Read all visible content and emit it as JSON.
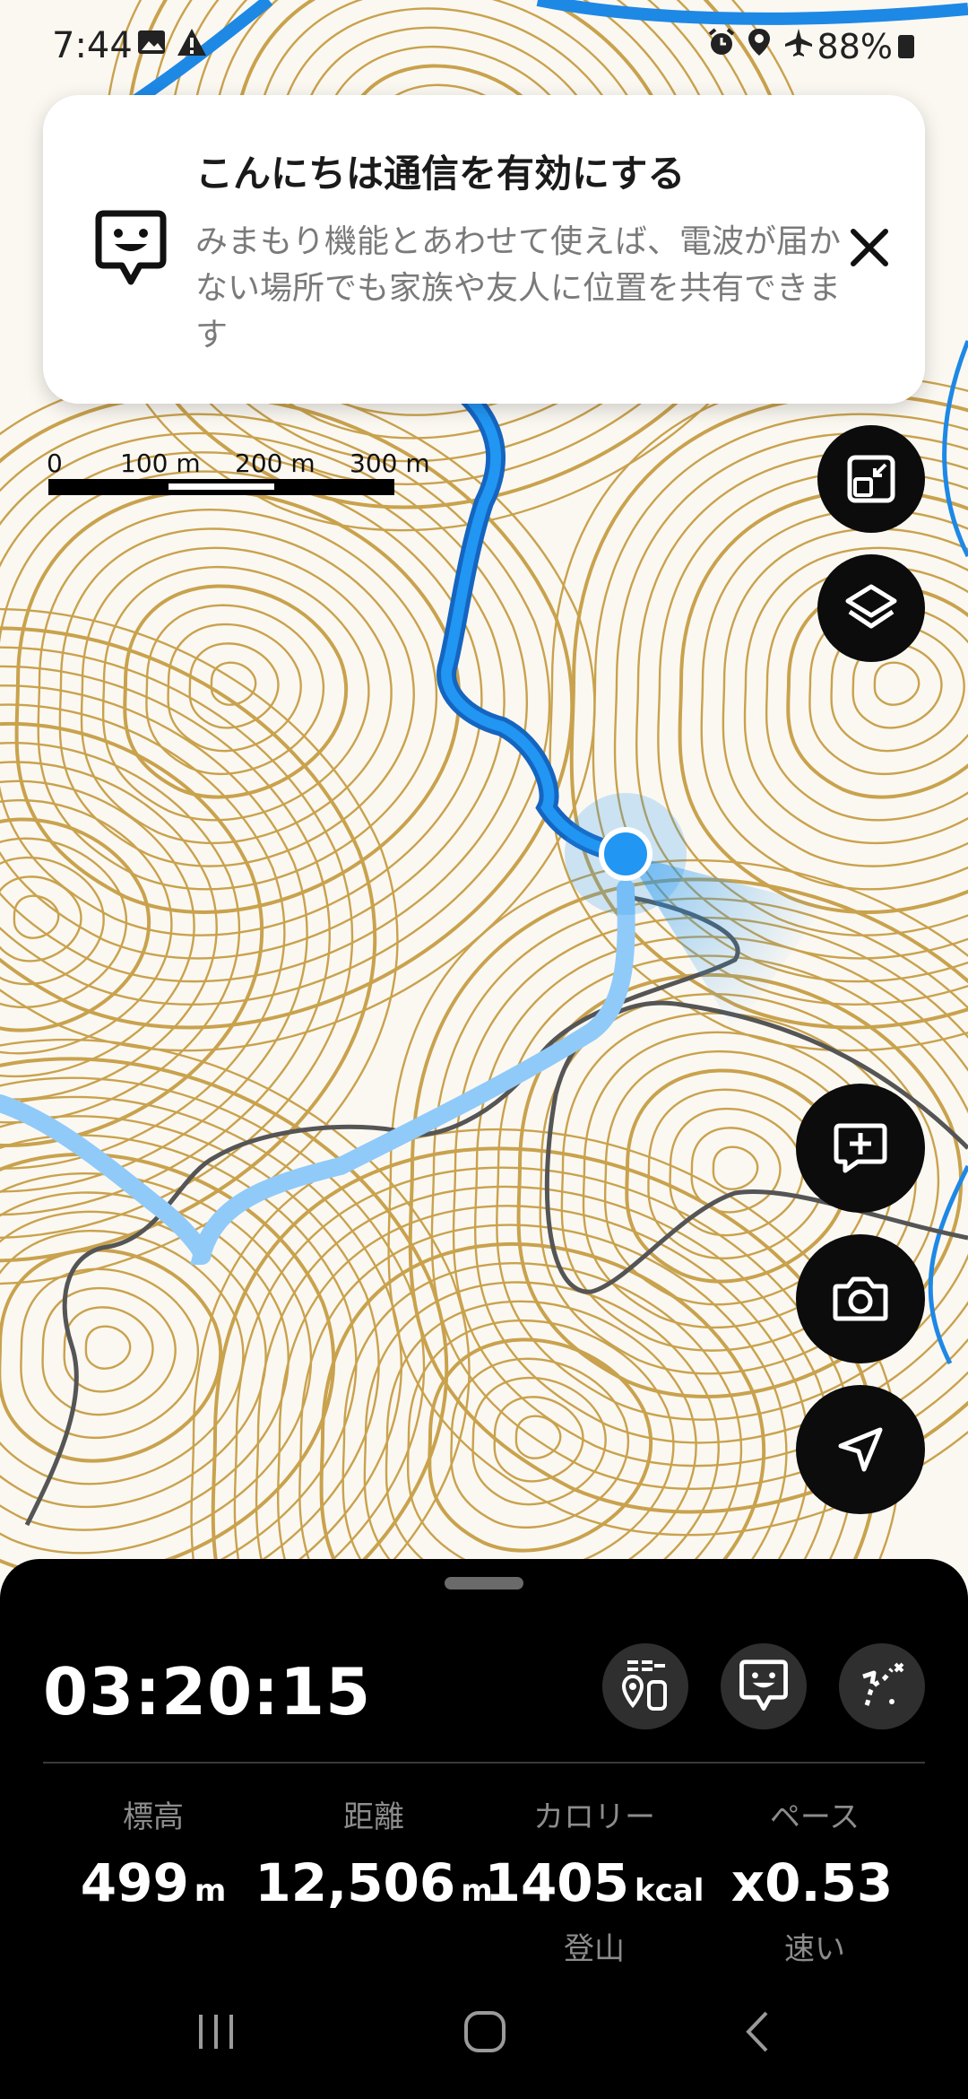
{
  "status_bar": {
    "time": "7:44",
    "battery": "88%",
    "left_icons": [
      "image-icon",
      "signal-warning-icon"
    ],
    "right_icons": [
      "alarm-icon",
      "location-icon",
      "airplane-icon",
      "battery-icon"
    ]
  },
  "notification": {
    "title": "こんにちは通信を有効にする",
    "body": "みまもり機能とあわせて使えば、電波が届かない場所でも家族や友人に位置を共有できます",
    "icon": "konnichiwa-logo-icon",
    "close_icon": "close-icon"
  },
  "scale": {
    "labels": [
      "0",
      "100 m",
      "200 m",
      "300 m"
    ]
  },
  "map": {
    "contour_color": "#c9a24d",
    "track_color": "#1e88e5",
    "route_color": "#555555",
    "location_color": "#2196f3"
  },
  "fabs": [
    "fullscreen-toggle-icon",
    "layers-icon",
    "add-memo-icon",
    "camera-icon",
    "navigate-icon"
  ],
  "activity": {
    "elapsed": "03:20:15",
    "buttons": [
      "gear-checklist-icon",
      "konnichiwa-icon",
      "route-icon"
    ],
    "stats": [
      {
        "label": "標高",
        "value": "499",
        "unit": "m",
        "sub": ""
      },
      {
        "label": "距離",
        "value": "12,506",
        "unit": "m",
        "sub": ""
      },
      {
        "label": "カロリー",
        "value": "1405",
        "unit": "kcal",
        "sub": "登山"
      },
      {
        "label": "ペース",
        "value": "x0.53",
        "unit": "",
        "sub": "速い"
      }
    ]
  },
  "navbar": [
    "recent-apps-icon",
    "home-icon",
    "back-icon"
  ]
}
